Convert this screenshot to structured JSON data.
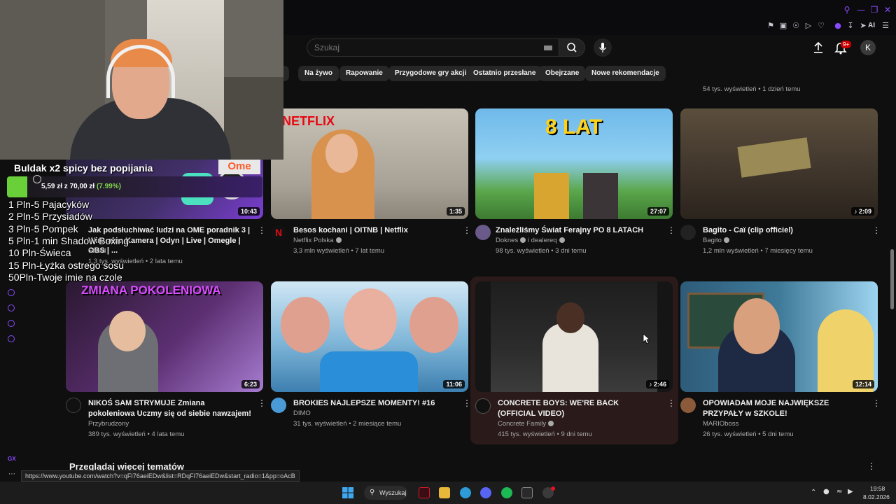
{
  "browser": {
    "ai_label": "AI"
  },
  "masthead": {
    "search_placeholder": "Szukaj",
    "notification_count": "9+",
    "avatar_letter": "K"
  },
  "chips": [
    "p",
    "Na żywo",
    "Rapowanie",
    "Przygodowe gry akcji",
    "Ostatnio przesłane",
    "Obejrzane",
    "Nowe rekomendacje"
  ],
  "row0_meta": "54 tys. wyświetleń • 1 dzień temu",
  "videos": [
    {
      "title": "Jak podsłuchiwać ludzi na OME poradnik 3 | Wirtualna Kamera | Odyn | Live | Omegle | OBS | ...",
      "channel": "Shard",
      "meta": "1,3 tys. wyświetleń • 2 lata temu",
      "duration": "10:43"
    },
    {
      "title": "Besos kochani | OITNB | Netflix",
      "channel": "Netflix Polska",
      "meta": "3,3 mln wyświetleń • 7 lat temu",
      "duration": "1:35",
      "thumb_text": "NETFLIX"
    },
    {
      "title": "Znaleźliśmy Świat Ferajny PO 8 LATACH",
      "channel": "Doknes",
      "channel2": "i dealereq",
      "meta": "98 tys. wyświetleń • 3 dni temu",
      "duration": "27:07",
      "thumb_text": "8 LAT"
    },
    {
      "title": "Bagito - Caï (clip officiel)",
      "channel": "Bagito",
      "meta": "1,2 mln wyświetleń • 7 miesięcy temu",
      "duration": "2:09"
    },
    {
      "title": "NIKOŚ SAM STRYMUJE Zmiana pokoleniowa Uczmy się od siebie nawzajem!",
      "channel": "Przybrudzony",
      "meta": "389 tys. wyświetleń • 4 lata temu",
      "duration": "6:23",
      "thumb_text": "ZMIANA POKOLENIOWA"
    },
    {
      "title": "BROKIES NAJLEPSZE MOMENTY! #16",
      "channel": "DIMO",
      "meta": "31 tys. wyświetleń • 2 miesiące temu",
      "duration": "11:06"
    },
    {
      "title": "CONCRETE BOYS: WE'RE BACK (OFFICIAL VIDEO)",
      "channel": "Concrete Family",
      "meta": "415 tys. wyświetleń • 9 dni temu",
      "duration": "2:46"
    },
    {
      "title": "OPOWIADAM MOJE NAJWIĘKSZE PRZYPAŁY w SZKOLE!",
      "channel": "MARIOboss",
      "meta": "26 tys. wyświetleń • 5 dni temu",
      "duration": "12:14"
    }
  ],
  "overlay": {
    "donation_title": "Buldak x2 spicy bez popijania",
    "donation_amount": "5,59 zł z 70,00 zł",
    "donation_pct": "(7.99%)",
    "ome_text": "Ome",
    "menu": [
      "1 Pln-5 Pajacyków",
      "2 Pln-5 Przysiadów",
      "3 Pln-5 Pompek",
      "5 Pln-1 min Shadow Boxing",
      "10 Pln-Świeca",
      "15 Pln-Łyżka ostrego sosu",
      "50Pln-Twoje imie na czole"
    ]
  },
  "section_title": "Przeglądaj więcej tematów",
  "status_url": "https://www.youtube.com/watch?v=qFI76aeiEDw&list=RDqFI76aeiEDw&start_radio=1&pp=oAcB",
  "rail_label": "GX",
  "taskbar": {
    "search_label": "Wyszukaj",
    "time": "19:58",
    "date": "8.02.2026"
  },
  "colors": {
    "accent": "#8a4bff",
    "youtube_red": "#cc0000",
    "page_bg": "#0f0f0f"
  }
}
